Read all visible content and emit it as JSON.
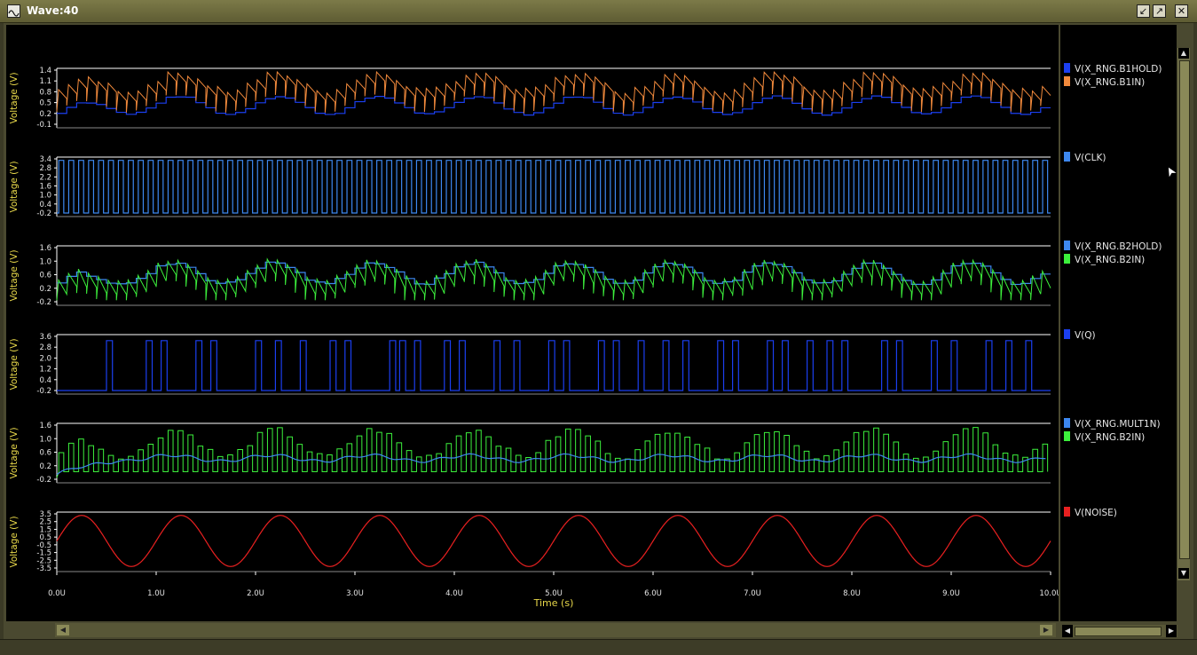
{
  "window": {
    "title": "Wave:40"
  },
  "panels": [
    {
      "ylabel": "Voltage (V)",
      "ticks": [
        "1.4",
        "1.1",
        "0.8",
        "0.5",
        "0.2",
        "-0.1"
      ],
      "legend": [
        {
          "name": "V(X_RNG.B1HOLD)",
          "color": "#1b3ff0"
        },
        {
          "name": "V(X_RNG.B1IN)",
          "color": "#f28a3c"
        }
      ]
    },
    {
      "ylabel": "Voltage (V)",
      "ticks": [
        "3.4",
        "2.8",
        "2.2",
        "1.6",
        "1.0",
        "0.4",
        "-0.2"
      ],
      "legend": [
        {
          "name": "V(CLK)",
          "color": "#3d88f0"
        }
      ]
    },
    {
      "ylabel": "Voltage (V)",
      "ticks": [
        "1.6",
        "1.0",
        "0.6",
        "0.2",
        "-0.2"
      ],
      "legend": [
        {
          "name": "V(X_RNG.B2HOLD)",
          "color": "#3d88f0"
        },
        {
          "name": "V(X_RNG.B2IN)",
          "color": "#3cf03c"
        }
      ]
    },
    {
      "ylabel": "Voltage (V)",
      "ticks": [
        "3.6",
        "2.8",
        "2.0",
        "1.2",
        "0.4",
        "-0.2"
      ],
      "legend": [
        {
          "name": "V(Q)",
          "color": "#1b3ff0"
        }
      ]
    },
    {
      "ylabel": "Voltage (V)",
      "ticks": [
        "1.6",
        "1.0",
        "0.6",
        "0.2",
        "-0.2"
      ],
      "legend": [
        {
          "name": "V(X_RNG.MULT1N)",
          "color": "#3d88f0"
        },
        {
          "name": "V(X_RNG.B2IN)",
          "color": "#3cf03c"
        }
      ]
    },
    {
      "ylabel": "Voltage (V)",
      "ticks": [
        "3.5",
        "2.5",
        "1.5",
        "0.5",
        "-0.5",
        "-1.5",
        "-2.5",
        "-3.5"
      ],
      "legend": [
        {
          "name": "V(NOISE)",
          "color": "#e82020"
        }
      ]
    }
  ],
  "xaxis": {
    "label": "Time (s)",
    "ticks": [
      "0.0U",
      "1.0U",
      "2.0U",
      "3.0U",
      "4.0U",
      "5.0U",
      "6.0U",
      "7.0U",
      "8.0U",
      "9.0U",
      "10.0U"
    ]
  },
  "chart_data": {
    "type": "line",
    "xlabel": "Time (s)",
    "xlim": [
      0,
      10.0
    ],
    "x_unit": "us",
    "note_series": "Six stacked transient-analysis waveform panels",
    "series": [
      {
        "name": "V(NOISE)",
        "shape": "sine",
        "amplitude": 3.3,
        "period_us": 1.0,
        "color": "#e82020"
      },
      {
        "name": "V(CLK)",
        "shape": "square",
        "low": -0.2,
        "high": 3.3,
        "period_us": 0.1,
        "color": "#3d88f0"
      },
      {
        "name": "V(Q)",
        "shape": "pulse",
        "low": -0.2,
        "high": 3.3,
        "color": "#1b3ff0"
      }
    ],
    "ylim_panels": [
      [
        -0.1,
        1.4
      ],
      [
        -0.2,
        3.4
      ],
      [
        -0.2,
        1.6
      ],
      [
        -0.2,
        3.6
      ],
      [
        -0.2,
        1.6
      ],
      [
        -3.5,
        3.5
      ]
    ]
  }
}
